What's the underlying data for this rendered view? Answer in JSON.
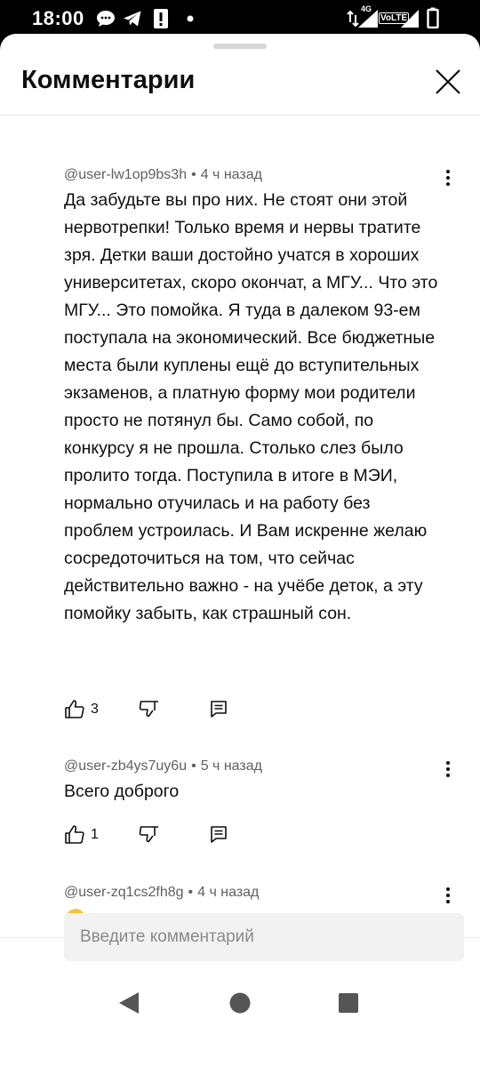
{
  "status_bar": {
    "time": "18:00",
    "network": "4G",
    "volte": "VoLTE",
    "icons": [
      "chat-bubble-icon",
      "telegram-icon",
      "alert-icon",
      "dot-icon",
      "data-arrows-icon",
      "signal-icon",
      "signal-icon",
      "battery-icon"
    ]
  },
  "sheet": {
    "title": "Комментарии",
    "close_icon": "close-icon"
  },
  "comments": [
    {
      "author": "@user-lw1op9bs3h",
      "time": "4 ч назад",
      "text": "Да забудьте вы про них. Не стоят они этой нервотрепки! Только время и нервы тратите зря. Детки ваши достойно учатся в хороших университетах, скоро окончат, а МГУ... Что это МГУ... Это помойка. Я туда в далеком 93-ем поступала на экономический. Все бюджетные места были куплены ещё до вступительных экзаменов, а платную форму мои родители просто не потянул бы. Само собой, по конкурсу я не прошла. Столько слез было пролито тогда. Поступила в итоге в МЭИ, нормально отучилась и на работу без проблем устроилась. И Вам искренне желаю сосредоточиться на том, что сейчас действительно важно - на учёбе деток, а эту помойку забыть, как страшный сон.",
      "likes": "3"
    },
    {
      "author": "@user-zb4ys7uy6u",
      "time": "5 ч назад",
      "text": "Всего доброго",
      "likes": "1"
    },
    {
      "author": "@user-zq1cs2fh8g",
      "time": "4 ч назад",
      "text": "",
      "emoji": "thinking-face-emoji",
      "likes": ""
    }
  ],
  "input": {
    "placeholder": "Введите комментарий"
  },
  "nav": {
    "icons": [
      "back-triangle-icon",
      "home-circle-icon",
      "recents-square-icon"
    ]
  },
  "colors": {
    "meta_gray": "#606060",
    "text": "#0f0f0f",
    "input_bg": "#f2f2f2",
    "nav_gray": "#555555"
  }
}
